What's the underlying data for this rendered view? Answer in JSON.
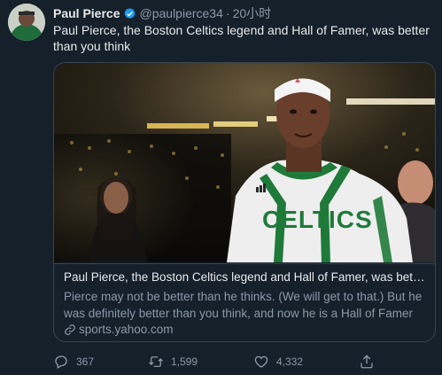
{
  "tweet": {
    "author_name": "Paul Pierce",
    "handle": "@paulpierce34",
    "separator": "·",
    "time": "20小时",
    "text": "Paul Pierce, the Boston Celtics legend and Hall of Famer, was better than you think"
  },
  "card": {
    "jersey_text": "CELTICS",
    "title": "Paul Pierce, the Boston Celtics legend and Hall of Famer, was better than you think",
    "description": "Pierce may not be better than he thinks. (We will get to that.) But he was definitely better than you think, and now he is a Hall of Famer who...",
    "domain": "sports.yahoo.com"
  },
  "actions": {
    "reply_count": "367",
    "retweet_count": "1,599",
    "like_count": "4,332"
  },
  "colors": {
    "background": "#15202b",
    "text": "#e7e9ea",
    "muted": "#8b98a5",
    "border": "#38444d",
    "verified": "#1d9bf0",
    "celtics_green": "#1f7a3a"
  },
  "icons": [
    "verified-badge-icon",
    "link-icon",
    "reply-icon",
    "retweet-icon",
    "like-icon",
    "share-icon"
  ]
}
